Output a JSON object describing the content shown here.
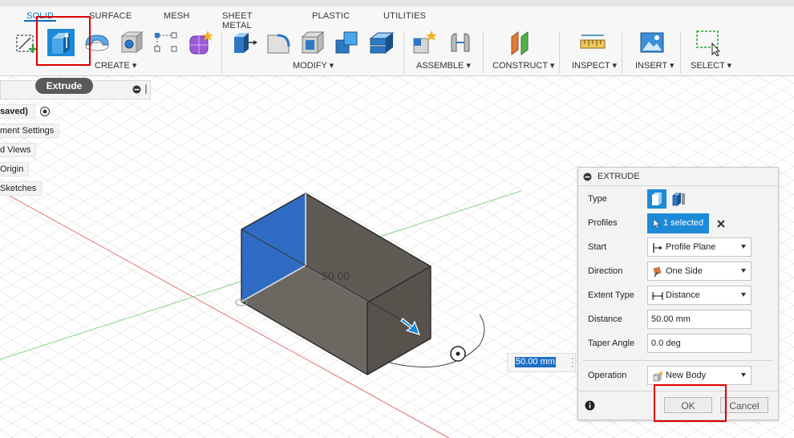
{
  "tabs": [
    {
      "label": "SOLID",
      "active": true
    },
    {
      "label": "SURFACE"
    },
    {
      "label": "MESH"
    },
    {
      "label": "SHEET METAL"
    },
    {
      "label": "PLASTIC"
    },
    {
      "label": "UTILITIES"
    }
  ],
  "toolbar_groups": {
    "create": "CREATE ▾",
    "modify": "MODIFY ▾",
    "assemble": "ASSEMBLE ▾",
    "construct": "CONSTRUCT ▾",
    "inspect": "INSPECT ▾",
    "insert": "INSERT ▾",
    "select": "SELECT ▾"
  },
  "browser": {
    "tooltip": "Extrude",
    "items": [
      "saved)",
      "ment Settings",
      "d Views",
      "Origin",
      "Sketches"
    ]
  },
  "viewport": {
    "dimension_label": "50.00",
    "distance_input": "50.00 mm"
  },
  "extrude_panel": {
    "title": "EXTRUDE",
    "rows": {
      "type": "Type",
      "profiles": "Profiles",
      "start": "Start",
      "direction": "Direction",
      "extent_type": "Extent Type",
      "distance": "Distance",
      "taper_angle": "Taper Angle",
      "operation": "Operation"
    },
    "profiles_selected": "1 selected",
    "start_value": "Profile Plane",
    "direction_value": "One Side",
    "extent_value": "Distance",
    "distance_value": "50.00 mm",
    "taper_value": "0.0 deg",
    "operation_value": "New Body",
    "ok_label": "OK",
    "cancel_label": "Cancel"
  },
  "colors": {
    "accent": "#1c8ad6",
    "highlight_red": "#e00000",
    "face_blue": "#2f6bc2",
    "body_gray": "#6b665c"
  }
}
